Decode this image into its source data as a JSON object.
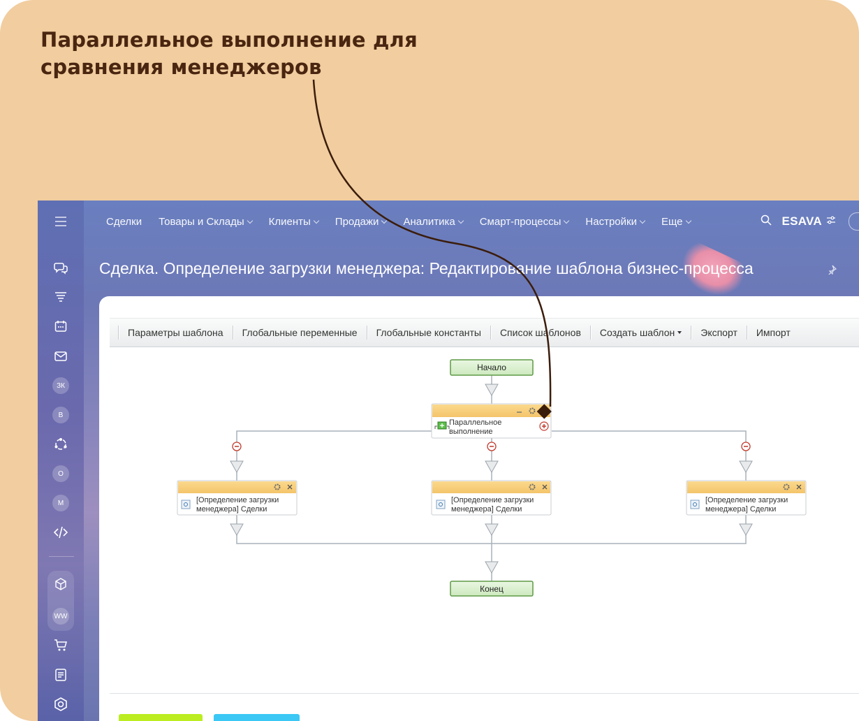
{
  "headline": {
    "line1": "Параллельное выполнение для",
    "line2": "сравнения менеджеров"
  },
  "sidebar": {
    "avatars": [
      "ЗК",
      "В",
      "О",
      "М",
      "WW"
    ]
  },
  "topnav": {
    "items": [
      {
        "label": "Сделки",
        "dropdown": false
      },
      {
        "label": "Товары и Склады",
        "dropdown": true
      },
      {
        "label": "Клиенты",
        "dropdown": true
      },
      {
        "label": "Продажи",
        "dropdown": true
      },
      {
        "label": "Аналитика",
        "dropdown": true
      },
      {
        "label": "Смарт-процессы",
        "dropdown": true
      },
      {
        "label": "Настройки",
        "dropdown": true
      },
      {
        "label": "Еще",
        "dropdown": true
      }
    ],
    "company": "ESAVA"
  },
  "page": {
    "title": "Сделка. Определение загрузки менеджера: Редактирование шаблона бизнес-процесса"
  },
  "toolbar": {
    "template_params": "Параметры шаблона",
    "global_vars": "Глобальные переменные",
    "global_consts": "Глобальные константы",
    "template_list": "Список шаблонов",
    "create_template": "Создать шаблон",
    "export": "Экспорт",
    "import": "Импорт"
  },
  "diagram": {
    "start": "Начало",
    "end": "Конец",
    "parallel_line1": "Параллельное",
    "parallel_line2": "выполнение",
    "branches": [
      {
        "line1": "[Определение загрузки",
        "line2": "менеджера] Сделки"
      },
      {
        "line1": "[Определение загрузки",
        "line2": "менеджера] Сделки"
      },
      {
        "line1": "[Определение загрузки",
        "line2": "менеджера] Сделки"
      }
    ]
  },
  "colors": {
    "frame_bg": "#f1cd9f",
    "headline": "#4a2611",
    "block_header": "#f8cf7e",
    "start_end_fill": "#d9f0cf",
    "start_end_border": "#6aa04a",
    "pointer": "#3b1d0c",
    "save_button": "#bbed21",
    "apply_button": "#3bc8f5"
  }
}
